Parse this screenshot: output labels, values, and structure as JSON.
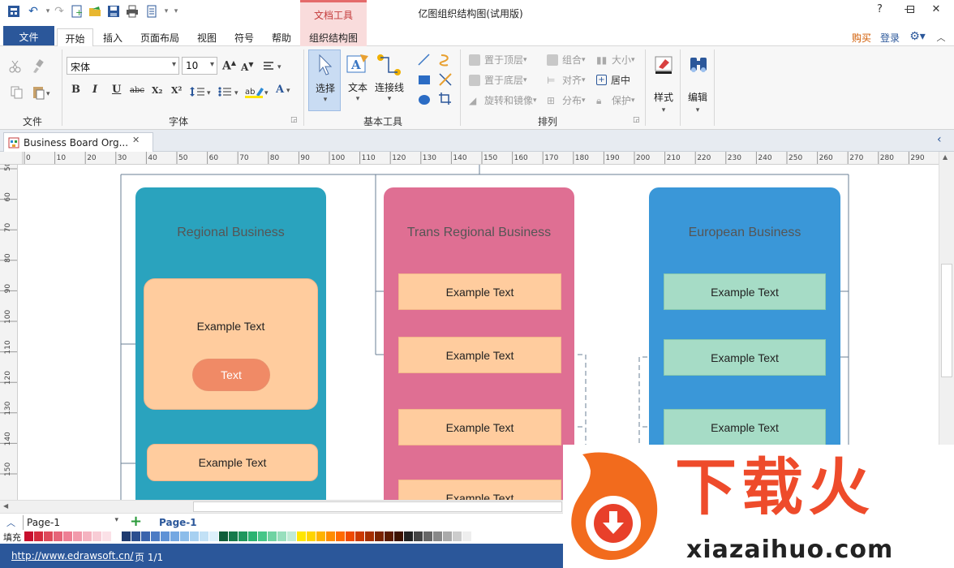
{
  "app": {
    "title": "亿图组织结构图(试用版)",
    "context_group": "文档工具"
  },
  "tabs": {
    "file": "文件",
    "home": "开始",
    "insert": "插入",
    "page_layout": "页面布局",
    "view": "视图",
    "symbols": "符号",
    "help": "帮助",
    "org_chart": "组织结构图"
  },
  "account": {
    "buy": "购买",
    "login": "登录"
  },
  "ribbon": {
    "groups": {
      "file": "文件",
      "font": "字体",
      "basic_tools": "基本工具",
      "arrange": "排列"
    },
    "font": {
      "family": "宋体",
      "size": "10"
    },
    "tools": {
      "select": "选择",
      "text": "文本",
      "connector": "连接线"
    },
    "arrange": {
      "bring_front": "置于顶层",
      "send_back": "置于底层",
      "rotate": "旋转和镜像",
      "group": "组合",
      "align": "对齐",
      "distribute": "分布",
      "size": "大小",
      "center": "居中",
      "protect": "保护"
    },
    "style": "样式",
    "edit": "编辑",
    "format_glyphs": {
      "bold": "B",
      "italic": "I",
      "underline": "U",
      "strike": "abc",
      "subscript": "X₂",
      "superscript": "X²",
      "grow": "A",
      "shrink": "A",
      "font_color": "A"
    }
  },
  "document": {
    "tab_name": "Business Board Org...",
    "close": "✕"
  },
  "rulers": {
    "h_ticks": [
      "0",
      "10",
      "20",
      "30",
      "40",
      "50",
      "60",
      "70",
      "80",
      "90",
      "100",
      "110",
      "120",
      "130",
      "140",
      "150",
      "160",
      "170",
      "180",
      "190",
      "200",
      "210",
      "220",
      "230",
      "240",
      "250",
      "260",
      "270",
      "280",
      "290"
    ],
    "v_ticks": [
      "50",
      "60",
      "70",
      "80",
      "90",
      "100",
      "110",
      "120",
      "130",
      "140",
      "150"
    ]
  },
  "diagram": {
    "columns": [
      {
        "title": "Regional Business",
        "color": "#2aa3be"
      },
      {
        "title": "Trans Regional Business",
        "color": "#df6f93"
      },
      {
        "title": "European Business",
        "color": "#3a97d8"
      }
    ],
    "regional": {
      "big_box": "Example Text",
      "pill": "Text",
      "box2": "Example Text"
    },
    "trans": [
      "Example Text",
      "Example Text",
      "Example Text",
      "Example Text"
    ],
    "european": [
      "Example Text",
      "Example Text",
      "Example Text"
    ],
    "colors": {
      "peach": "#ffcc9e",
      "pill": "#f08a66",
      "mint": "#a6dcc6"
    }
  },
  "pages": {
    "current": "Page-1",
    "tab": "Page-1",
    "add": "+"
  },
  "fill_label": "填充",
  "status": {
    "url": "http://www.edrawsoft.cn/",
    "page_info": "页 1/1"
  },
  "watermark": {
    "brand": "下载火",
    "domain": "xiazaihuo.com"
  },
  "palette": [
    "#c8102e",
    "#d42a3c",
    "#de4a5a",
    "#e66478",
    "#ee7f94",
    "#f29aab",
    "#f5b3c0",
    "#f8ccd5",
    "#fbe1e7",
    "#ffffff",
    "#1f3b70",
    "#2c4f8f",
    "#3a64ad",
    "#4b7bc4",
    "#5e92d6",
    "#74a8e2",
    "#8cbdea",
    "#a7d0f1",
    "#c2e1f6",
    "#dcf0fb",
    "#0f5e3a",
    "#167a4b",
    "#1f975d",
    "#2bb371",
    "#46c688",
    "#6fd3a2",
    "#98dfbd",
    "#c0ebd6",
    "#ffe600",
    "#ffd400",
    "#ffb300",
    "#ff8c00",
    "#ff6a00",
    "#ef4a00",
    "#cc3a00",
    "#a52f00",
    "#7a2400",
    "#5b1b00",
    "#3d1200",
    "#222222",
    "#444444",
    "#666666",
    "#888888",
    "#aaaaaa",
    "#cccccc",
    "#eeeeee"
  ]
}
